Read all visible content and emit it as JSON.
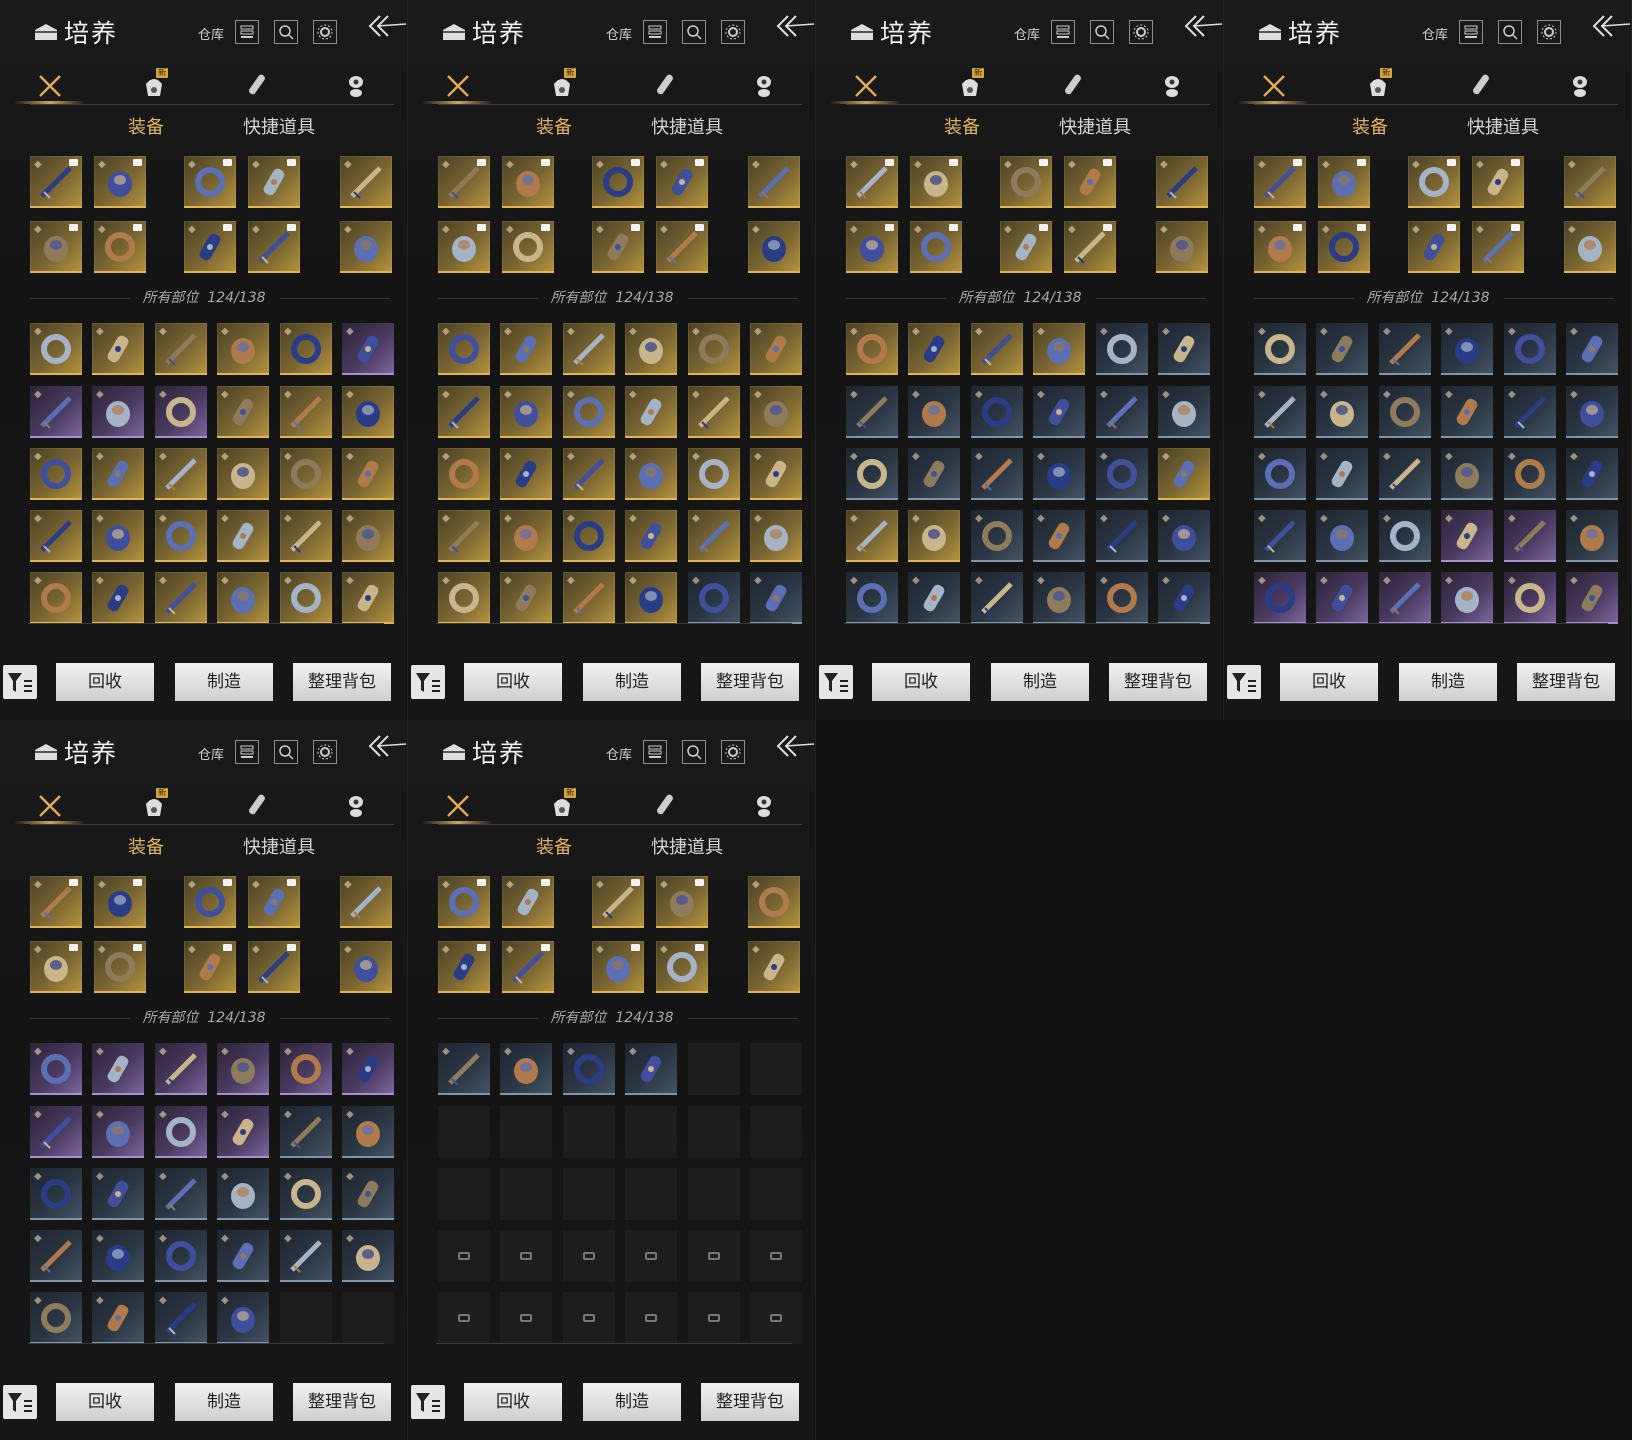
{
  "header": {
    "title": "培养",
    "warehouse_label": "仓库"
  },
  "icons": {
    "logo": "chest-icon",
    "warehouse": "storage-icon",
    "search": "search-icon",
    "settings": "gear-icon",
    "back": "back-arrow-icon",
    "tab1": "crossed-swords-icon",
    "tab2": "bag-icon",
    "tab3": "scroll-icon",
    "tab4": "token-icon",
    "filter": "filter-icon"
  },
  "tabs": {
    "new_badge": "新"
  },
  "subtabs": {
    "equipment": "装备",
    "quick_items": "快捷道具"
  },
  "counter": {
    "label": "所有部位",
    "value": "124/138"
  },
  "buttons": {
    "recycle": "回收",
    "craft": "制造",
    "sort": "整理背包"
  },
  "colors": {
    "accent": "#e3b36a",
    "gold_rarity": "#e0b552",
    "purple_rarity": "#a88fd0",
    "blue_rarity": "#7f95aa"
  },
  "panels": [
    {
      "grid": [
        [
          "g",
          "g",
          "g",
          "g",
          "g",
          "p"
        ],
        [
          "p",
          "p",
          "p",
          "g",
          "g",
          "g"
        ],
        [
          "g",
          "g",
          "g",
          "g",
          "g",
          "g"
        ],
        [
          "g",
          "g",
          "g",
          "g",
          "g",
          "g"
        ],
        [
          "g",
          "g",
          "g",
          "g",
          "g",
          "g"
        ]
      ]
    },
    {
      "grid": [
        [
          "g",
          "g",
          "g",
          "g",
          "g",
          "g"
        ],
        [
          "g",
          "g",
          "g",
          "g",
          "g",
          "g"
        ],
        [
          "g",
          "g",
          "g",
          "g",
          "g",
          "g"
        ],
        [
          "g",
          "g",
          "g",
          "g",
          "g",
          "g"
        ],
        [
          "g",
          "g",
          "g",
          "g",
          "b",
          "b"
        ]
      ]
    },
    {
      "grid": [
        [
          "g",
          "g",
          "g",
          "g",
          "b",
          "b"
        ],
        [
          "b",
          "b",
          "b",
          "b",
          "b",
          "b"
        ],
        [
          "b",
          "b",
          "b",
          "b",
          "b",
          "g"
        ],
        [
          "g",
          "g",
          "b",
          "b",
          "b",
          "b"
        ],
        [
          "b",
          "b",
          "b",
          "b",
          "b",
          "b"
        ]
      ]
    },
    {
      "grid": [
        [
          "b",
          "b",
          "b",
          "b",
          "b",
          "b"
        ],
        [
          "b",
          "b",
          "b",
          "b",
          "b",
          "b"
        ],
        [
          "b",
          "b",
          "b",
          "b",
          "b",
          "b"
        ],
        [
          "b",
          "b",
          "b",
          "p",
          "p",
          "b"
        ],
        [
          "p",
          "p",
          "p",
          "p",
          "p",
          "p"
        ]
      ]
    },
    {
      "grid": [
        [
          "p",
          "p",
          "p",
          "p",
          "p",
          "p"
        ],
        [
          "p",
          "p",
          "p",
          "p",
          "b",
          "b"
        ],
        [
          "b",
          "b",
          "b",
          "b",
          "b",
          "b"
        ],
        [
          "b",
          "b",
          "b",
          "b",
          "b",
          "b"
        ],
        [
          "b",
          "b",
          "b",
          "b",
          "e",
          "e"
        ]
      ]
    },
    {
      "grid": [
        [
          "b",
          "b",
          "b",
          "b",
          "e",
          "e"
        ],
        [
          "e",
          "e",
          "e",
          "e",
          "e",
          "e"
        ],
        [
          "e",
          "e",
          "e",
          "e",
          "e",
          "e"
        ],
        [
          "l",
          "l",
          "l",
          "l",
          "l",
          "l"
        ],
        [
          "l",
          "l",
          "l",
          "l",
          "l",
          "l"
        ]
      ]
    }
  ]
}
